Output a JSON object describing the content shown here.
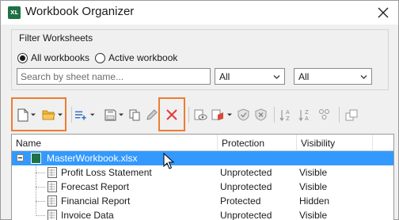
{
  "window": {
    "title": "Workbook Organizer",
    "app_icon_label": "XL"
  },
  "filter": {
    "title": "Filter Worksheets",
    "radio_all": "All workbooks",
    "radio_active": "Active workbook",
    "search_placeholder": "Search by sheet name...",
    "protection_select": "All",
    "visibility_select": "All"
  },
  "toolbar": {
    "highlight_color": "#ed7d31",
    "icons": [
      "new-file-icon",
      "open-folder-icon",
      "add-list-icon",
      "save-icon",
      "copy-icon",
      "rename-pencil-icon",
      "delete-x-icon",
      "hide-eye-icon",
      "protect-icon",
      "shield-check-icon",
      "shield-x-icon",
      "sort-az-icon",
      "sort-za-icon",
      "tab-color-icon",
      "copy-window-icon"
    ]
  },
  "grid": {
    "columns": [
      "Name",
      "Protection",
      "Visibility"
    ],
    "workbook": {
      "name": "MasterWorkbook.xlsx"
    },
    "rows": [
      {
        "name": "Profit Loss Statement",
        "protection": "Unprotected",
        "visibility": "Visible"
      },
      {
        "name": "Forecast Report",
        "protection": "Unprotected",
        "visibility": "Visible"
      },
      {
        "name": "Financial Report",
        "protection": "Protected",
        "visibility": "Hidden"
      },
      {
        "name": "Invoice Data",
        "protection": "Unprotected",
        "visibility": "Visible"
      }
    ]
  },
  "colors": {
    "selection": "#3399ff",
    "excel_green": "#1e7145",
    "delete_red": "#e53935"
  }
}
